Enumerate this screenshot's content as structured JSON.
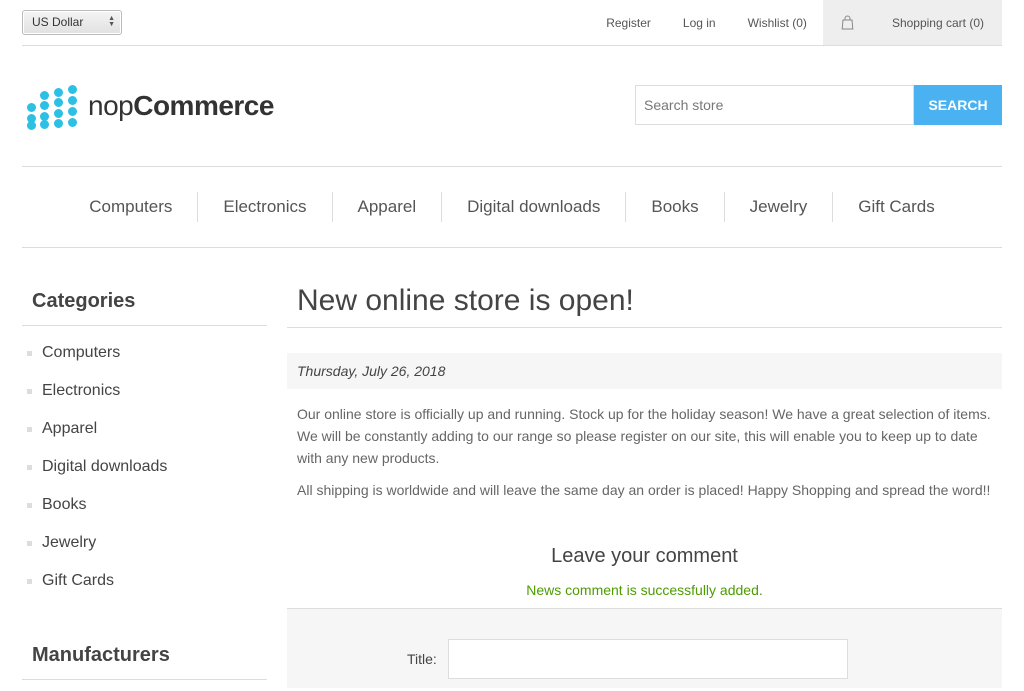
{
  "header": {
    "currency": "US Dollar",
    "links": {
      "register": "Register",
      "login": "Log in",
      "wishlist": "Wishlist (0)",
      "cart": "Shopping cart (0)"
    }
  },
  "logo": {
    "light": "nop",
    "bold": "Commerce"
  },
  "search": {
    "placeholder": "Search store",
    "button": "SEARCH"
  },
  "menu": [
    "Computers",
    "Electronics",
    "Apparel",
    "Digital downloads",
    "Books",
    "Jewelry",
    "Gift Cards"
  ],
  "sidebar": {
    "categories_title": "Categories",
    "categories": [
      "Computers",
      "Electronics",
      "Apparel",
      "Digital downloads",
      "Books",
      "Jewelry",
      "Gift Cards"
    ],
    "manufacturers_title": "Manufacturers"
  },
  "news": {
    "title": "New online store is open!",
    "date": "Thursday, July 26, 2018",
    "paragraph1": "Our online store is officially up and running. Stock up for the holiday season! We have a great selection of items. We will be constantly adding to our range so please register on our site, this will enable you to keep up to date with any new products.",
    "paragraph2": "All shipping is worldwide and will leave the same day an order is placed! Happy Shopping and spread the word!!"
  },
  "comment": {
    "title": "Leave your comment",
    "result": "News comment is successfully added.",
    "title_label": "Title:",
    "title_value": ""
  },
  "colors": {
    "accent": "#4ab2f1",
    "logo": "#2bc0e4",
    "success": "#4d9c00"
  }
}
